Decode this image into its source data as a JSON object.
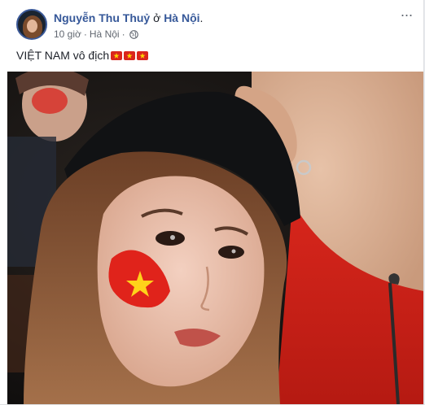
{
  "post": {
    "author": "Nguyễn Thu Thuỷ",
    "at_word": "ở",
    "location": "Hà Nội",
    "time": "10 giờ",
    "separator": "·",
    "meta_location": "Hà Nội",
    "privacy_icon": "globe-icon",
    "more_icon": "more-options-icon",
    "more_label": "···",
    "status_text": "VIỆT NAM vô địch",
    "status_emojis": [
      "vietnam-flag",
      "vietnam-flag",
      "vietnam-flag"
    ],
    "photo_icon": "selfie-photo"
  },
  "colors": {
    "link": "#365899",
    "meta": "#616770",
    "flag_red": "#da251d",
    "flag_star": "#ffd700"
  }
}
